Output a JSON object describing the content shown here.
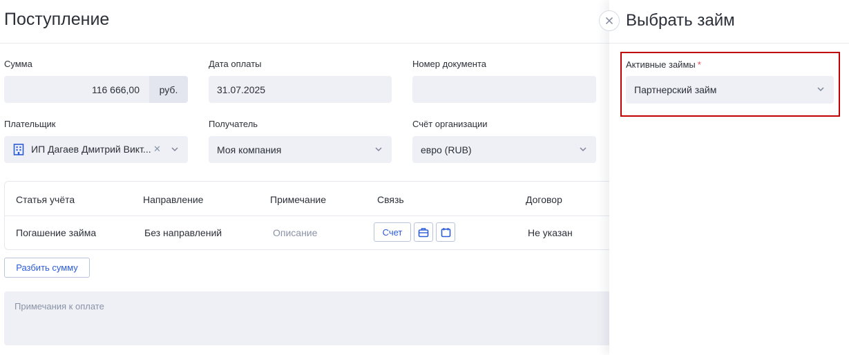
{
  "main": {
    "title": "Поступление",
    "fields": {
      "sum": {
        "label": "Сумма",
        "value": "116 666,00",
        "unit": "руб."
      },
      "payment_date": {
        "label": "Дата оплаты",
        "value": "31.07.2025"
      },
      "doc_number": {
        "label": "Номер документа",
        "value": ""
      },
      "payer": {
        "label": "Плательщик",
        "value": "ИП Дагаев Дмитрий Викт...",
        "icon": "building-icon"
      },
      "recipient": {
        "label": "Получатель",
        "value": "Моя компания"
      },
      "org_account": {
        "label": "Счёт организации",
        "value": "евро (RUB)"
      }
    },
    "table": {
      "headers": [
        "Статья учёта",
        "Направление",
        "Примечание",
        "Связь",
        "Договор"
      ],
      "row": {
        "article": "Погашение займа",
        "direction": "Без направлений",
        "note_placeholder": "Описание",
        "link_button": "Счет",
        "contract": "Не указан"
      }
    },
    "split_button": "Разбить сумму",
    "notes_placeholder": "Примечания к оплате"
  },
  "panel": {
    "title": "Выбрать займ",
    "loans_label": "Активные займы",
    "required_mark": "*",
    "loans_value": "Партнерский займ"
  },
  "colors": {
    "accent": "#2c5bd6",
    "field_bg": "#eef0f5",
    "highlight": "#c00000",
    "required": "#e2474a"
  }
}
